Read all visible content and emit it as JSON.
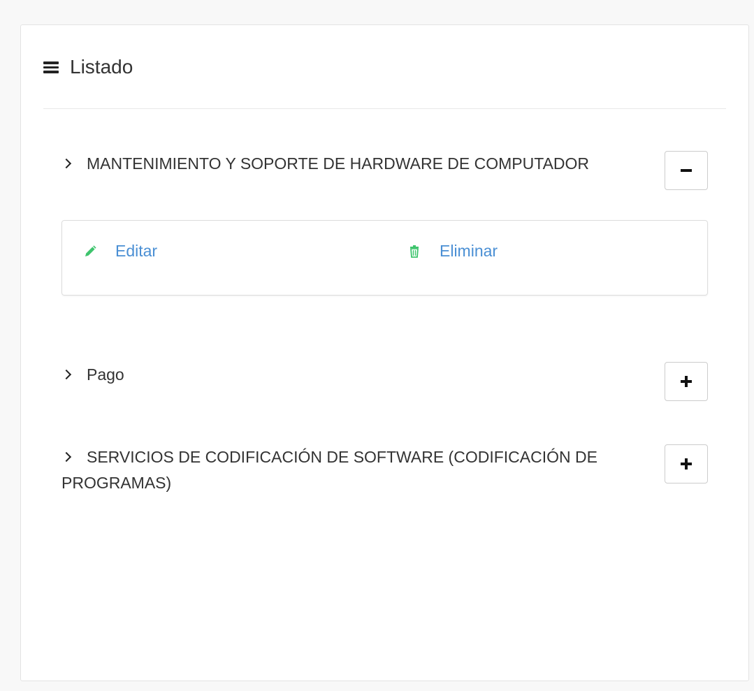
{
  "header": {
    "title": "Listado",
    "icon": "bars-icon"
  },
  "items": [
    {
      "title": "MANTENIMIENTO Y SOPORTE DE HARDWARE DE COMPUTADOR",
      "expanded": true,
      "toggle_icon": "minus-icon",
      "actions": {
        "edit_label": "Editar",
        "edit_icon": "pencil-icon",
        "delete_label": "Eliminar",
        "delete_icon": "trash-icon"
      }
    },
    {
      "title": "Pago",
      "expanded": false,
      "toggle_icon": "plus-icon"
    },
    {
      "title": "SERVICIOS DE CODIFICACIÓN DE SOFTWARE (CODIFICACIÓN DE PROGRAMAS)",
      "expanded": false,
      "toggle_icon": "plus-icon"
    }
  ],
  "colors": {
    "link": "#4a8fd4",
    "icon_green": "#3ec46d",
    "text": "#333333",
    "border": "#dddddd"
  }
}
